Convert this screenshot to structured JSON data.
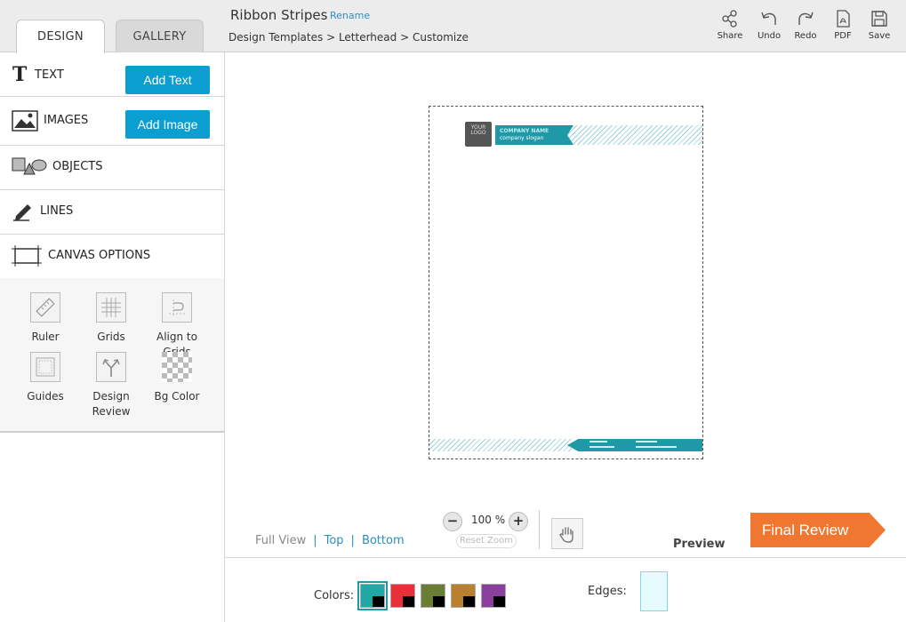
{
  "tabs": {
    "design": "DESIGN",
    "gallery": "GALLERY"
  },
  "header": {
    "title": "Ribbon Stripes",
    "rename": "Rename",
    "breadcrumb": "Design Templates > Letterhead > Customize"
  },
  "toolbar": {
    "share": "Share",
    "undo": "Undo",
    "redo": "Redo",
    "pdf": "PDF",
    "save": "Save"
  },
  "sidebar": {
    "text": {
      "label": "TEXT",
      "button": "Add Text"
    },
    "images": {
      "label": "IMAGES",
      "button": "Add Image"
    },
    "objects": {
      "label": "OBJECTS"
    },
    "lines": {
      "label": "LINES"
    },
    "canvas": {
      "label": "CANVAS OPTIONS"
    },
    "canvas_tools": [
      "Ruler",
      "Grids",
      "Align to Grids",
      "Guides",
      "Design Review",
      "Bg Color"
    ]
  },
  "letterhead": {
    "logo_text": "YOUR LOGO",
    "company_name": "COMPANY NAME",
    "company_slogan": "company slogan"
  },
  "view": {
    "full_view": "Full View",
    "top": "Top",
    "bottom": "Bottom",
    "sep": "|"
  },
  "zoom": {
    "minus": "−",
    "plus": "+",
    "value": "100 %",
    "reset": "Reset Zoom"
  },
  "preview_label": "Preview",
  "final_review": "Final Review",
  "colors": {
    "label": "Colors:",
    "swatches": [
      "#1fa8a6",
      "#e8303a",
      "#6a7d34",
      "#b9802f",
      "#8a3f9f"
    ]
  },
  "edges": {
    "label": "Edges:"
  },
  "accent": "#0b9fd1",
  "brand_teal": "#1f98a7",
  "cta_orange": "#f0772f"
}
